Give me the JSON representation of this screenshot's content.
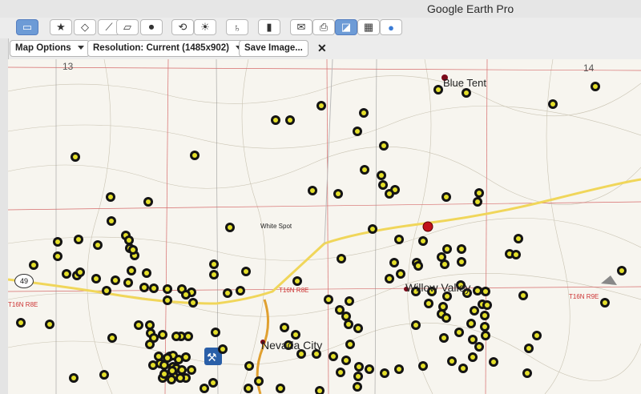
{
  "window": {
    "title": "Google Earth Pro"
  },
  "toolbar": {
    "buttons": [
      {
        "name": "sidebar-toggle",
        "glyph": "▭",
        "selected": true
      },
      {
        "name": "add-placemark",
        "glyph": "★"
      },
      {
        "name": "add-polygon",
        "glyph": "◇"
      },
      {
        "name": "add-path",
        "glyph": "⟋"
      },
      {
        "name": "add-image-overlay",
        "glyph": "▱"
      },
      {
        "name": "record-tour",
        "glyph": "⏺"
      },
      {
        "name": "historical-imagery",
        "glyph": "⟲"
      },
      {
        "name": "sunlight",
        "glyph": "☀"
      },
      {
        "name": "switch-sky",
        "glyph": "♄"
      },
      {
        "name": "ruler",
        "glyph": "▮"
      },
      {
        "name": "email",
        "glyph": "✉"
      },
      {
        "name": "print",
        "glyph": "⎙"
      },
      {
        "name": "save-image",
        "glyph": "◪",
        "selected": true
      },
      {
        "name": "view-in-maps",
        "glyph": "▦"
      },
      {
        "name": "earth-gallery",
        "glyph": "●"
      }
    ]
  },
  "options_bar": {
    "map_options": "Map Options",
    "resolution": "Resolution: Current (1485x902)",
    "save_image": "Save Image...",
    "close": "✕"
  },
  "map": {
    "labels": {
      "blue_tent": "Blue Tent",
      "willow_valley": "Willow Valley",
      "nevada_city": "Nevada City",
      "section_13": "13",
      "section_14": "14",
      "white_spot": "White Spot",
      "route_49": "49",
      "t16n_r8e_left": "T16N R8E",
      "t16n_r8e_mid": "T16N R8E",
      "t16n_r9e": "T16N R9E"
    }
  }
}
